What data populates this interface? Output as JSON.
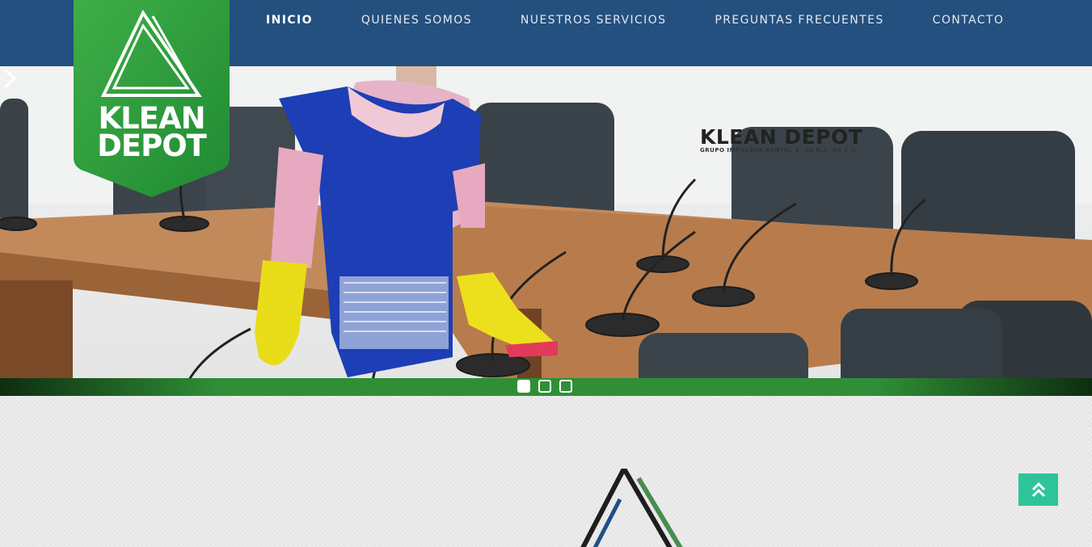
{
  "colors": {
    "header_bg": "#23507f",
    "brand_green": "#2e9c3e",
    "slider_bar": "#2f8f36",
    "scroll_top_bg": "#2ec49a",
    "content_bg": "#e9e9e9"
  },
  "logo": {
    "line1": "KLEAN",
    "line2": "DEPOT",
    "icon": "triangle-logo-icon"
  },
  "nav": {
    "items": [
      {
        "label": "INICIO",
        "active": true
      },
      {
        "label": "QUIENES SOMOS",
        "active": false
      },
      {
        "label": "NUESTROS SERVICIOS",
        "active": false
      },
      {
        "label": "PREGUNTAS FRECUENTES",
        "active": false
      },
      {
        "label": "CONTACTO",
        "active": false
      }
    ]
  },
  "slider": {
    "slides_total": 3,
    "active_slide": 1,
    "next_icon": "chevron-right-icon",
    "image": "conference-room-cleaning-photo"
  },
  "content": {
    "brand_title": "KLEAN DEPOT",
    "brand_subtitle": "GRUPO IMPULSOR RENTAL S. DE R.L. DE C.V."
  },
  "scroll_top": {
    "icon": "double-chevron-up-icon"
  }
}
